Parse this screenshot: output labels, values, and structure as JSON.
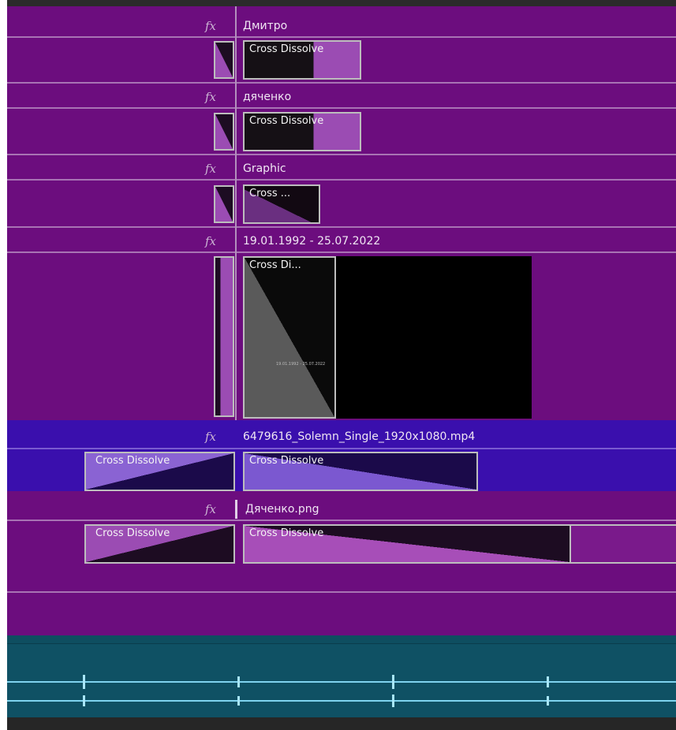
{
  "tracks": {
    "v6": {
      "clip_name": "Дмитро",
      "transition_label": "Cross Dissolve"
    },
    "v5": {
      "clip_name": "дяченко",
      "transition_label": "Cross Dissolve"
    },
    "v4": {
      "clip_name": "Graphic",
      "transition_label": "Cross ..."
    },
    "v3": {
      "clip_name": "19.01.1992 - 25.07.2022",
      "transition_label": "Cross Di...",
      "thumbnail_text": "19.01.1992 - 25.07.2022"
    },
    "v2": {
      "clip_name": "6479616_Solemn_Single_1920x1080.mp4",
      "left_transition_label": "Cross Dissolve",
      "transition_label": "Cross Dissolve"
    },
    "v1": {
      "clip_name": "Дяченко.png",
      "left_transition_label": "Cross Dissolve",
      "transition_label": "Cross Dissolve"
    }
  },
  "fx_badge": "fx",
  "colors": {
    "video_clip": "#6c0d7e",
    "selected_clip": "#3a0fad",
    "audio_clip": "#0f5164",
    "waveform": "#7fd3ef"
  }
}
